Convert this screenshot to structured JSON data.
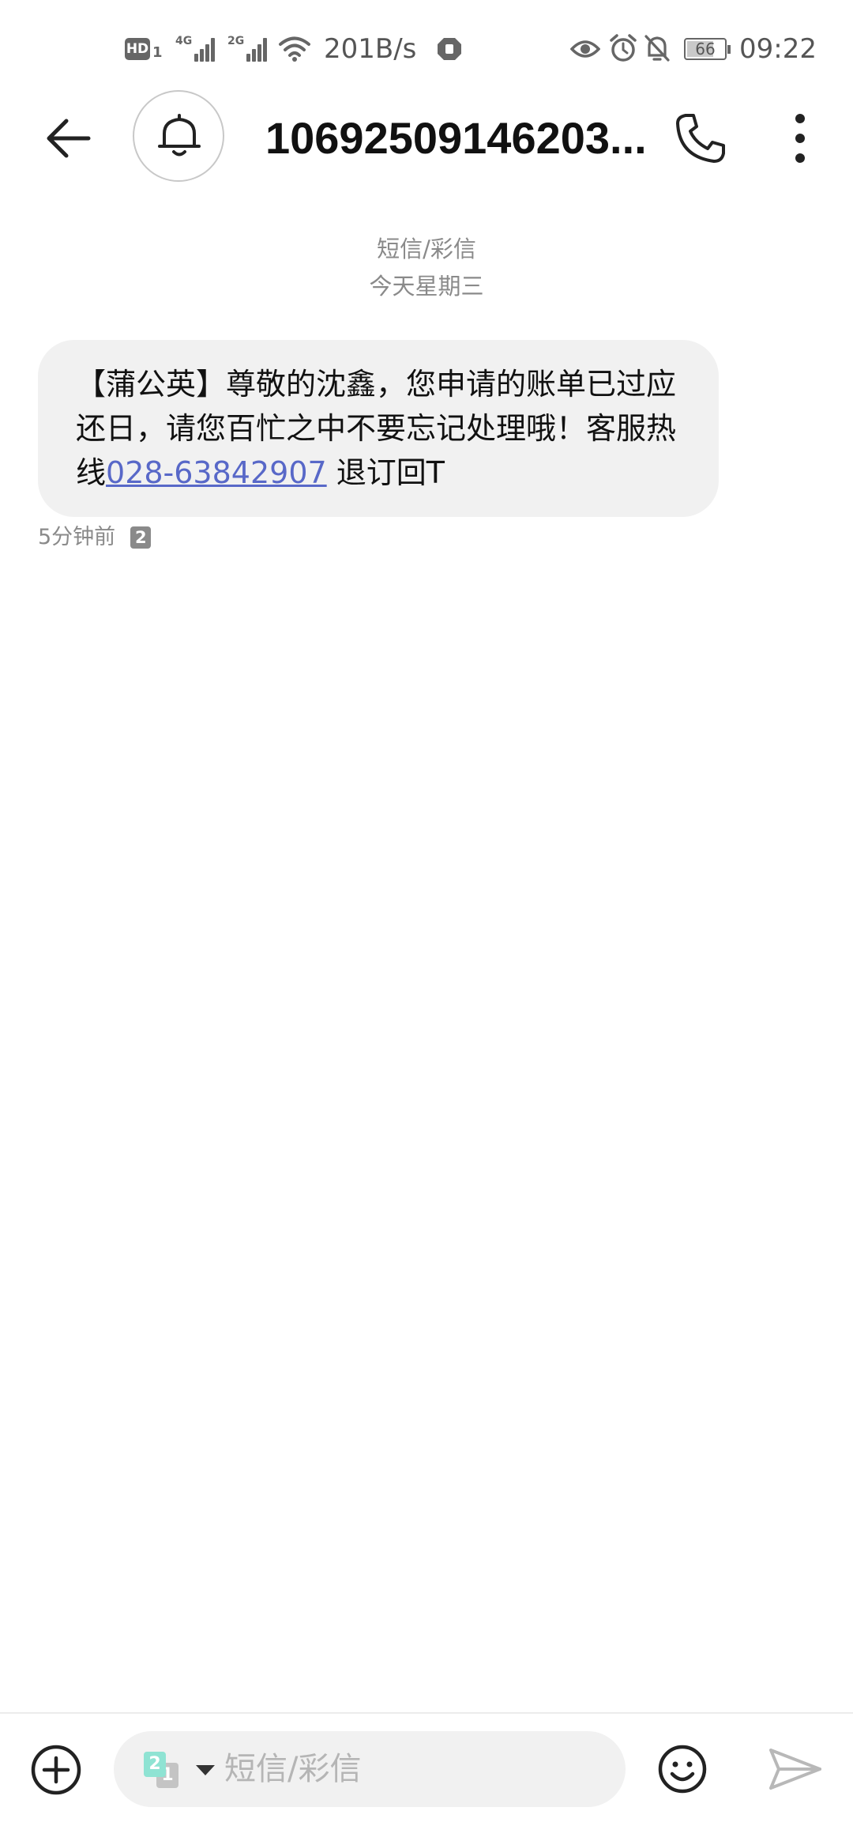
{
  "status_bar": {
    "hd_label": "HD",
    "hd_sim": "1",
    "net1_label": "4G",
    "net2_label": "2G",
    "net_speed": "201B/s",
    "battery_level": "66",
    "time": "09:22",
    "icons": [
      "hd-icon",
      "signal-icon",
      "wifi-icon",
      "shield-icon",
      "eye-icon",
      "alarm-icon",
      "bell-off-icon",
      "battery-icon"
    ]
  },
  "header": {
    "title": "10692509146203...",
    "icons": [
      "back-arrow-icon",
      "bell-icon",
      "phone-icon",
      "more-vert-icon"
    ]
  },
  "conversation": {
    "type_label": "短信/彩信",
    "date_label": "今天星期三"
  },
  "message": {
    "text_before_link": "【蒲公英】尊敬的沈鑫，您申请的账单已过应还日，请您百忙之中不要忘记处理哦！客服热线",
    "link_text": "028-63842907",
    "text_after_link": " 退订回T",
    "time": "5分钟前",
    "sim_badge": "2"
  },
  "composer": {
    "placeholder": "短信/彩信",
    "sim_front": "2",
    "sim_back": "1",
    "icons": [
      "add-icon",
      "sim-switch-icon",
      "emoji-icon",
      "send-icon"
    ]
  },
  "colors": {
    "bubble_bg": "#f1f1f1",
    "link": "#5868c8",
    "meta_text": "#8a8a8a",
    "sim_accent": "#8fe3d3"
  }
}
